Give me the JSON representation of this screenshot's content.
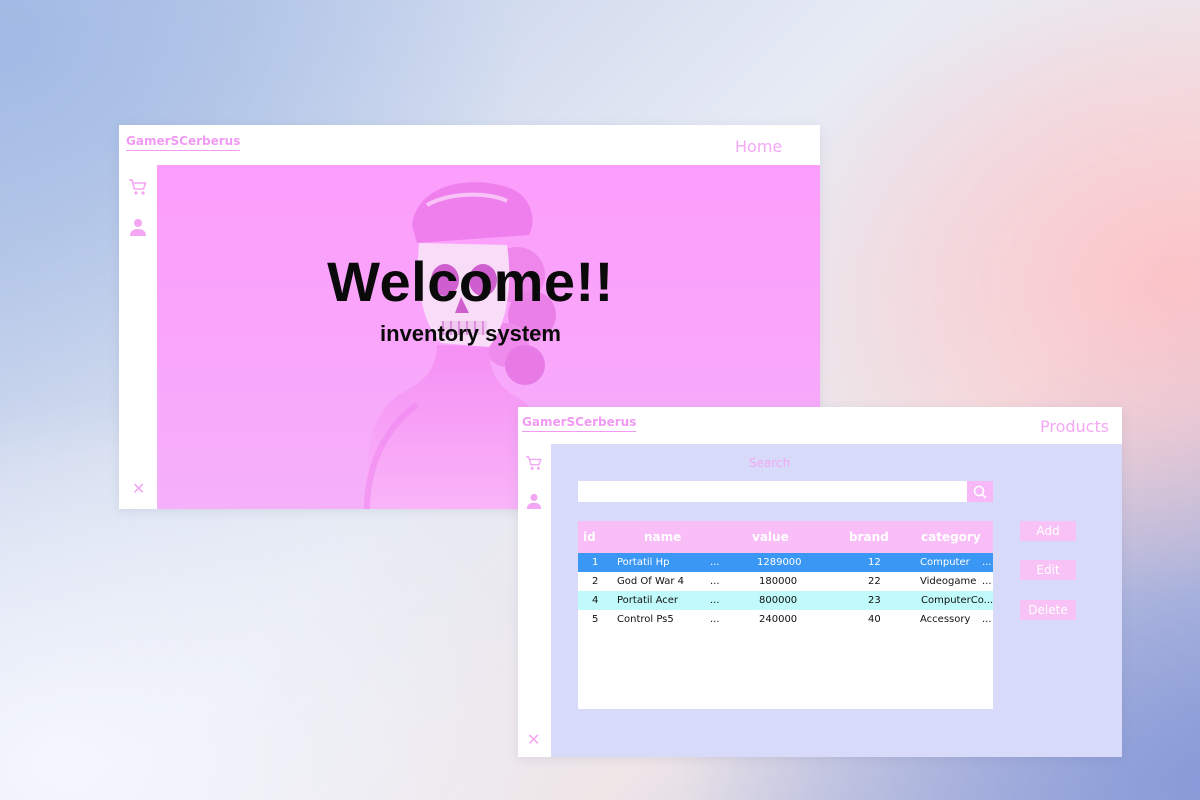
{
  "home_window": {
    "brand": "GamerSCerberus",
    "page_title": "Home",
    "heading": "Welcome!!",
    "subheading": "inventory system"
  },
  "products_window": {
    "brand": "GamerSCerberus",
    "page_title": "Products",
    "search_label": "Search",
    "search_value": "",
    "columns": [
      "id",
      "name",
      "value",
      "brand",
      "category"
    ],
    "rows": [
      {
        "id": "1",
        "name": "Portatil Hp",
        "dots": "...",
        "value": "1289000",
        "brand": "12",
        "category": "Computer",
        "dots2": "..."
      },
      {
        "id": "2",
        "name": "God Of War 4",
        "dots": "...",
        "value": "180000",
        "brand": "22",
        "category": "Videogame",
        "dots2": "..."
      },
      {
        "id": "4",
        "name": "Portatil Acer",
        "dots": "...",
        "value": "800000",
        "brand": "23",
        "category": "ComputerCo...",
        "dots2": ""
      },
      {
        "id": "5",
        "name": "Control Ps5",
        "dots": "...",
        "value": "240000",
        "brand": "40",
        "category": "Accessory",
        "dots2": "..."
      }
    ],
    "selected_row_id": "1",
    "highlighted_row_id": "4",
    "actions": {
      "add": "Add",
      "edit": "Edit",
      "delete": "Delete"
    }
  },
  "icons": [
    "cart-icon",
    "user-icon",
    "close-icon",
    "search-icon"
  ],
  "colors": {
    "accent_pink": "#f19af3",
    "hero_pink": "#fc9dfb",
    "panel_lavender": "#d7daf8",
    "selected_row": "#3a97f4",
    "highlight_row": "#c0fafa",
    "button_pink": "#f9c2f7"
  }
}
